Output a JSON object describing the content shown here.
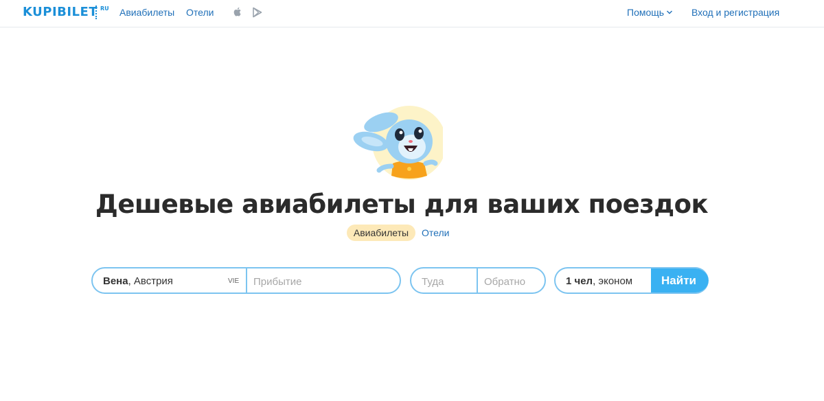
{
  "header": {
    "logo": "KUPIBILET",
    "logo_suffix": "RU",
    "nav_flights": "Авиабилеты",
    "nav_hotels": "Отели",
    "help": "Помощь",
    "login": "Вход и регистрация"
  },
  "hero": {
    "title": "Дешевые авиабилеты для ваших поездок"
  },
  "tabs": {
    "flights": "Авиабилеты",
    "hotels": "Отели"
  },
  "search": {
    "from_city": "Вена",
    "from_country": ", Австрия",
    "from_code": "VIE",
    "to_placeholder": "Прибытие",
    "depart_placeholder": "Туда",
    "return_placeholder": "Обратно",
    "pax_count": "1 чел",
    "pax_class": ", эконом",
    "find_label": "Найти"
  },
  "colors": {
    "brand": "#1b8fd8",
    "link": "#1f6fb8",
    "accent_button": "#3ab1f2",
    "field_border": "#7cc4f0",
    "tab_active_bg": "#fde9b8"
  }
}
